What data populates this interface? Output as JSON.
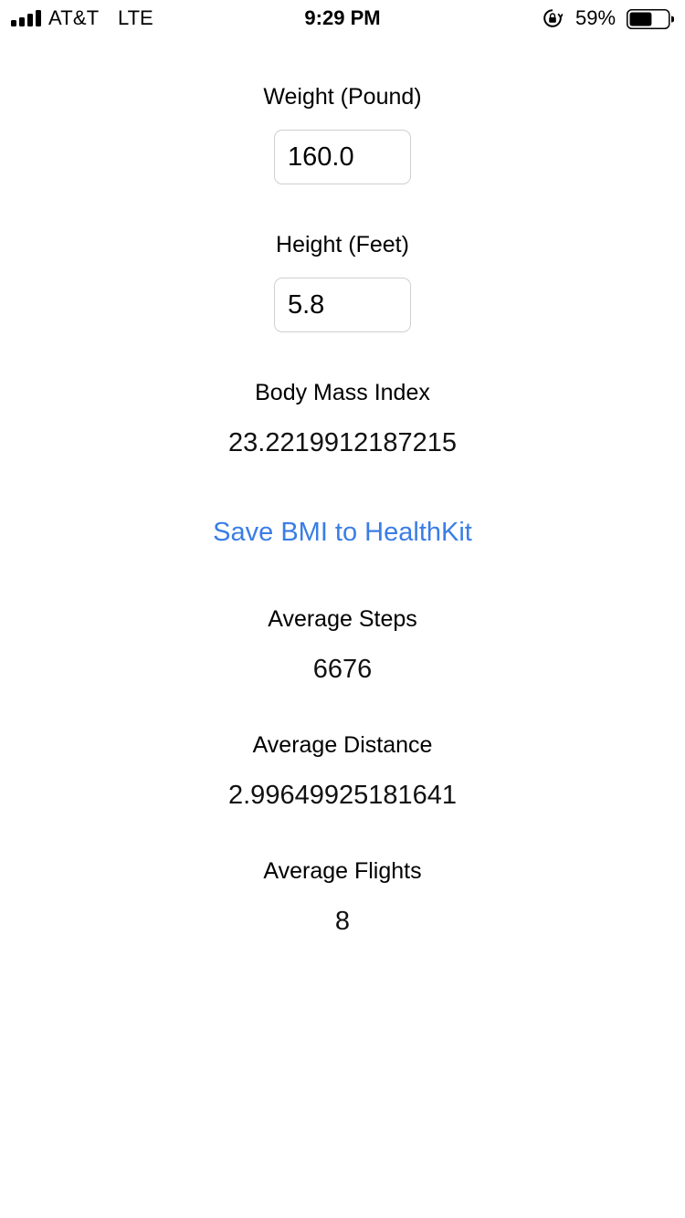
{
  "status_bar": {
    "carrier": "AT&T",
    "network": "LTE",
    "time": "9:29 PM",
    "battery_percent": "59%",
    "battery_level": 0.59,
    "icons": [
      "signal-bars-icon",
      "rotation-lock-icon",
      "battery-icon"
    ]
  },
  "weight": {
    "label": "Weight (Pound)",
    "value": "160.0"
  },
  "height": {
    "label": "Height (Feet)",
    "value": "5.8"
  },
  "bmi": {
    "label": "Body Mass Index",
    "value": "23.2219912187215"
  },
  "save_button": {
    "label": "Save BMI to HealthKit",
    "color": "#3a7de6"
  },
  "steps": {
    "label": "Average Steps",
    "value": "6676"
  },
  "distance": {
    "label": "Average Distance",
    "value": "2.99649925181641"
  },
  "flights": {
    "label": "Average Flights",
    "value": "8"
  }
}
